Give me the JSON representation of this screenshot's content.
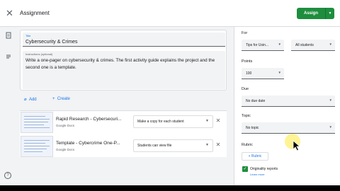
{
  "header": {
    "title": "Assignment",
    "assign_label": "Assign",
    "close_icon": "close-icon",
    "dropdown_icon": "chevron-down-icon"
  },
  "rail": {
    "icons": [
      "assignment-icon",
      "stream-icon"
    ],
    "help_icon": "help-icon"
  },
  "form": {
    "title_label": "Title",
    "title_value": "Cybersecurity & Crimes",
    "instructions_label": "Instructions (optional)",
    "instructions_value": "Write a one-pager on cybersecurity & crimes.  The first activity guide explains the project and the second one is a template."
  },
  "actions": {
    "add_label": "Add",
    "create_label": "Create"
  },
  "attachments": [
    {
      "title": "Rapid Research - Cybersecuri...",
      "type": "Google Docs",
      "sharing": "Make a copy for each student"
    },
    {
      "title": "Template - Cybercrime One-P...",
      "type": "Google Docs",
      "sharing": "Students can view file"
    }
  ],
  "sidebar": {
    "for_label": "For",
    "class_value": "Tips for Usin...",
    "students_value": "All students",
    "points_label": "Points",
    "points_value": "100",
    "due_label": "Due",
    "due_value": "No due date",
    "topic_label": "Topic",
    "topic_value": "No topic",
    "rubric_label": "Rubric",
    "rubric_button": "Rubric",
    "originality_label": "Originality reports",
    "learn_more": "Learn more"
  },
  "colors": {
    "accent_green": "#1e8e3e",
    "link_blue": "#1a73e8",
    "background": "#f1f3f4"
  }
}
